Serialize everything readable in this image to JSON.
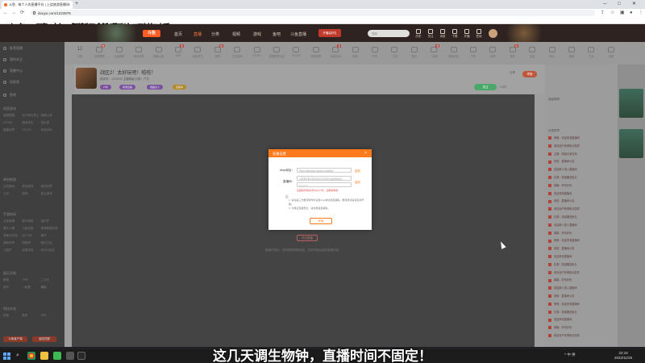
{
  "browser": {
    "tab_title": "斗鱼 - 每个人的直播平台 | 上饶旅游直播间",
    "tab_close": "×",
    "new_tab": "+",
    "win_min": "─",
    "win_max": "□",
    "win_close": "✕",
    "back": "←",
    "forward": "→",
    "reload": "⟳",
    "url": "douyu.com/1223975",
    "bookmarks": [
      "斗鱼 - 每个人的直播",
      "百度一下，你就知道",
      "腾讯视频",
      "哔哩哔哩直播"
    ]
  },
  "header": {
    "logo": "斗鱼",
    "nav": [
      "首页",
      "直播",
      "分类",
      "视频",
      "游戏",
      "鱼吧",
      "斗鱼直播"
    ],
    "active_nav": "直播",
    "promo": "开播赢好礼",
    "search_placeholder": "搜索",
    "icons": [
      "历史",
      "关注",
      "消息",
      "下载",
      "开播",
      "签到"
    ]
  },
  "sidebar": {
    "top_items": [
      "推荐直播",
      "我的关注",
      "直播中心",
      "短视频",
      "鱼吧"
    ],
    "sections": [
      {
        "title": "网游竞技",
        "items": [
          "英雄联盟",
          "地下城与勇士",
          "穿越火线",
          "DOTA2",
          "绝地求生",
          "逆水寒",
          "魔兽世界",
          "CS:GO",
          "永劫无间"
        ]
      },
      {
        "title": "单机热游",
        "items": [
          "主机游戏",
          "怀旧游戏",
          "我的世界",
          "方舟",
          "原神",
          "独立游戏"
        ]
      },
      {
        "title": "手游休闲",
        "items": [
          "王者荣耀",
          "和平精英",
          "金铲铲",
          "第五人格",
          "火影忍者",
          "英雄联盟手游",
          "球球大作战",
          "QQ飞车",
          "崩坏",
          "迷你世界",
          "阴阳师",
          "明日之后",
          "三国杀",
          "部落冲突",
          "欢乐斗地主"
        ]
      },
      {
        "title": "娱乐天地",
        "items": [
          "颜值",
          "户外",
          "二次元",
          "音乐",
          "一起看",
          "舞蹈"
        ]
      },
      {
        "title": "科技文化",
        "items": [
          "科普",
          "数码",
          "汽车"
        ]
      }
    ],
    "bottom_pills": [
      "斗鱼客户端",
      "返回顶部"
    ]
  },
  "categories": [
    {
      "label": "分类",
      "count": "12"
    },
    {
      "label": "英雄联盟",
      "badge": "热"
    },
    {
      "label": "王者荣耀"
    },
    {
      "label": "和平精英"
    },
    {
      "label": "穿越火线"
    },
    {
      "label": "DNF",
      "badge": "新"
    },
    {
      "label": "绝地求生"
    },
    {
      "label": "原神",
      "badge": "热"
    },
    {
      "label": "主机游戏"
    },
    {
      "label": "CS:GO"
    },
    {
      "label": "英雄联盟手游"
    },
    {
      "label": "DOTA2"
    },
    {
      "label": "我的世界"
    },
    {
      "label": "永劫无间",
      "badge": "新"
    },
    {
      "label": "颜值"
    },
    {
      "label": "户外"
    },
    {
      "label": "二次元"
    },
    {
      "label": "音乐"
    },
    {
      "label": "一起看",
      "badge": "热"
    },
    {
      "label": "数码科技"
    },
    {
      "label": "汽车"
    },
    {
      "label": "体育"
    },
    {
      "label": "更多",
      "badge": "新"
    },
    {
      "label": "交友"
    },
    {
      "label": "电台"
    },
    {
      "label": "美食"
    },
    {
      "label": "文化"
    },
    {
      "label": "全部"
    }
  ],
  "room": {
    "title": "战区2！太好玩吧！啦啦！",
    "meta": "房间号：1223975  主播等级  分类：户外",
    "tags": [
      "户外",
      "旅游直播",
      "舞蹈达人",
      "直播中"
    ],
    "follow_btn": "关注",
    "report_btn": "举报",
    "follow_count": "1.5万",
    "share_btn": "分享"
  },
  "modal": {
    "title": "直播设置",
    "close": "×",
    "rtmp_label": "rtmp地址：",
    "rtmp_value": "rtmp://sendtc3.douyu.com/live",
    "rtmp_copy": "复制",
    "code_label": "直播码：",
    "code_value": "1223975rXXXXXXXXXXX?wsSecret=",
    "code_mask": "••••••••••",
    "code_copy": "复制",
    "warn": "直播码有效时间为24小时，过期请刷新",
    "note_title": "注：",
    "notes": [
      "1. 请在第三方推流软件中设置rtmp地址和直播码，推流成功后将自动开播。",
      "2. 为保证直播安全，请勿泄露直播码。"
    ],
    "ok_btn": "开始"
  },
  "close_live_btn": "关闭直播",
  "below_tip": "直播开始后，请勿随意刷新页面，否则可能会造成直播中断。",
  "right_panel": {
    "rank_title": "贡献周榜",
    "header": "本周勋章",
    "rows": [
      "房管：欢迎来到直播间",
      "恭喜用户获得粉丝勋章",
      "主播：感谢大家支持",
      "系统：直播间公告",
      "欢迎新人进入直播间",
      "礼物：感谢赠送鱼丸",
      "弹幕：好玩好玩",
      "欢迎来到直播间",
      "系统：直播间公告",
      "恭喜用户获得粉丝勋章",
      "礼物：感谢赠送鱼丸",
      "欢迎新人进入直播间",
      "弹幕：好玩好玩",
      "房管：欢迎来到直播间",
      "系统：直播间公告",
      "欢迎来到直播间",
      "礼物：感谢赠送鱼丸",
      "恭喜用户获得粉丝勋章",
      "弹幕：好玩好玩",
      "欢迎新人进入直播间",
      "系统：直播间公告",
      "房管：欢迎来到直播间",
      "礼物：感谢赠送鱼丸",
      "欢迎来到直播间",
      "弹幕：好玩好玩",
      "恭喜用户获得粉丝勋章"
    ]
  },
  "subtitle": "这几天调生物钟，直播时间不固定！",
  "taskbar": {
    "search": "⌕",
    "tray": "^ 中 拼",
    "time": "22:15",
    "date": "2022/11/25"
  },
  "colors": {
    "accent": "#ff7a1b",
    "douyu_orange": "#ff5d23",
    "overlay_page": "#9e9e9e",
    "player": "#444444"
  }
}
